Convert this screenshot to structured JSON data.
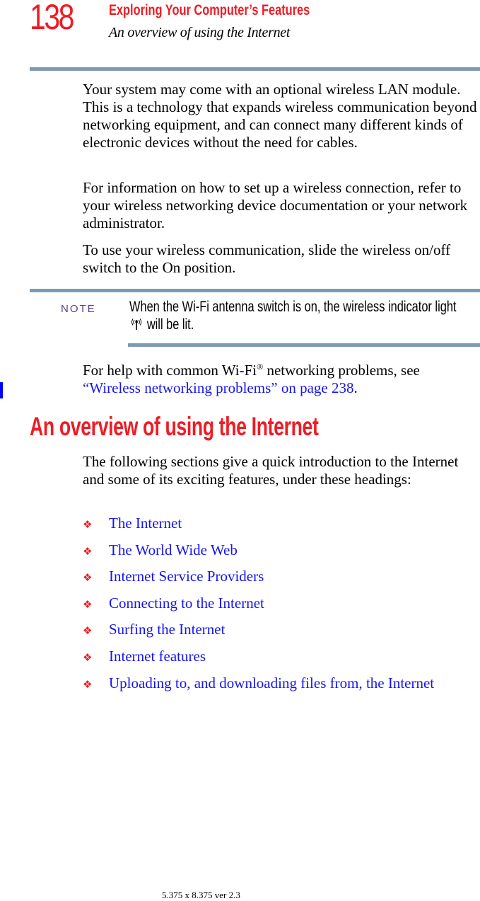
{
  "header": {
    "page_number": "138",
    "chapter_title": "Exploring Your Computer’s Features",
    "section_subtitle": "An overview of using the Internet"
  },
  "intro_paragraphs": [
    "Your system may come with an optional wireless LAN module. This is a technology that expands wireless communication beyond networking equipment, and can connect many different kinds of electronic devices without the need for cables.",
    "For information on how to set up a wireless connection, refer to your wireless networking device documentation or your network administrator.",
    "To use your wireless communication, slide the wireless on/off switch to the On position."
  ],
  "note": {
    "label": "NOTE",
    "text_before_icon": "When the Wi-Fi antenna switch is on, the wireless indicator light",
    "icon": "wireless-indicator-icon",
    "text_after_icon": "will be lit."
  },
  "help_paragraph": {
    "text_before": "For help with common Wi-Fi",
    "registered_mark": "®",
    "text_middle": " networking problems, see",
    "link_text": "“Wireless networking problems” on page 238",
    "text_after": "."
  },
  "section": {
    "heading": "An overview of using the Internet",
    "intro": "The following sections give a quick introduction to the Internet and some of its exciting features, under these headings:",
    "bullet_glyph": "❖",
    "items": [
      "The Internet",
      "The World Wide Web",
      "Internet Service Providers",
      "Connecting to the Internet",
      "Surfing the Internet",
      "Internet features",
      "Uploading to, and downloading files from, the Internet"
    ]
  },
  "footer": {
    "text": "5.375 x 8.375 ver 2.3"
  },
  "colors": {
    "accent_red": "#ee1c25",
    "rule_blue_gray": "#7d9ab3",
    "link_blue": "#1515f0",
    "note_label_purple": "#5a3b9a",
    "change_bar_blue": "#0000ff"
  }
}
